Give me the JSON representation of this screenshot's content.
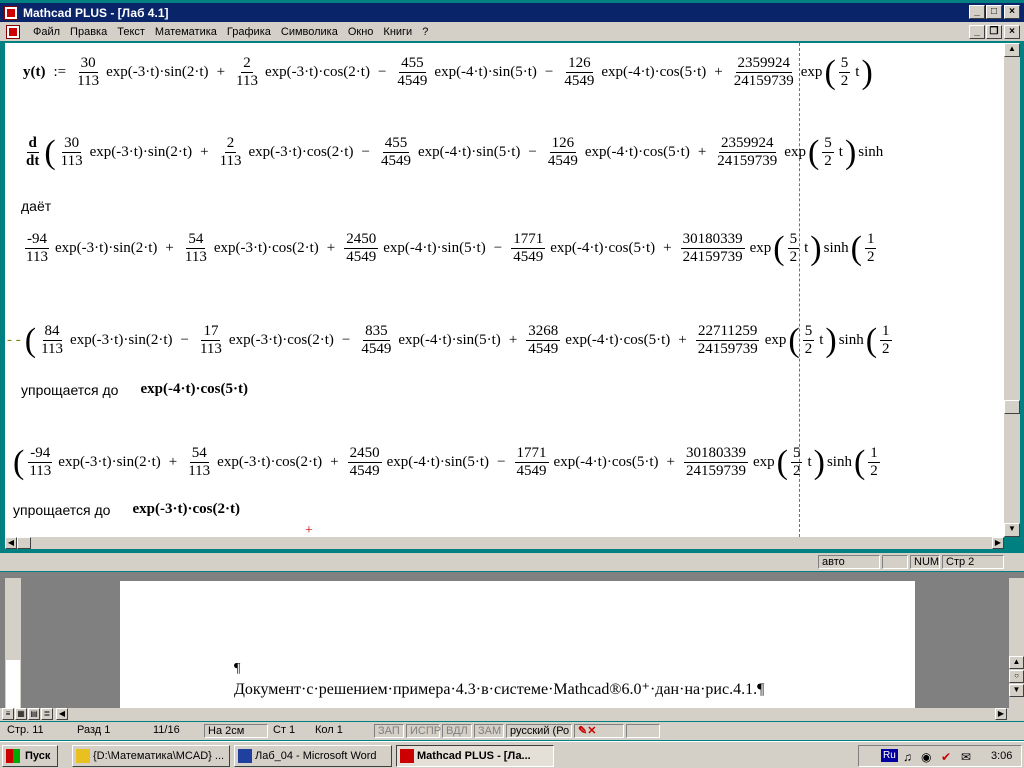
{
  "window": {
    "title": "Mathcad PLUS - [Лаб 4.1]"
  },
  "menu": [
    "Файл",
    "Правка",
    "Текст",
    "Математика",
    "Графика",
    "Символика",
    "Окно",
    "Книги",
    "?"
  ],
  "math": {
    "y_label": "y(t)",
    "assign": ":=",
    "deriv_d": "d",
    "deriv_dt": "dt",
    "gives": "даёт",
    "simplifies1": "упрощается до",
    "result1": "exp(-4·t)·cos(5·t)",
    "simplifies2": "упрощается до",
    "result2": "exp(-3·t)·cos(2·t)",
    "row1": {
      "n1": "30",
      "d1": "113",
      "t1": "exp(-3·t)·sin(2·t)",
      "o1": "+",
      "n2": "2",
      "d2": "113",
      "t2": "exp(-3·t)·cos(2·t)",
      "o2": "−",
      "n3": "455",
      "d3": "4549",
      "t3": "exp(-4·t)·sin(5·t)",
      "o3": "−",
      "n4": "126",
      "d4": "4549",
      "t4": "exp(-4·t)·cos(5·t)",
      "o4": "+",
      "n5": "2359924",
      "d5": "24159739",
      "t5": "exp",
      "n6": "5",
      "d6": "2",
      "t6": "t"
    },
    "row3": {
      "n1": "-94",
      "d1": "113",
      "t1": "exp(-3·t)·sin(2·t)",
      "o1": "+",
      "n2": "54",
      "d2": "113",
      "t2": "exp(-3·t)·cos(2·t)",
      "o2": "+",
      "n3": "2450",
      "d3": "4549",
      "t3": "exp(-4·t)·sin(5·t)",
      "o3": "−",
      "n4": "1771",
      "d4": "4549",
      "t4": "exp(-4·t)·cos(5·t)",
      "o4": "+",
      "n5": "30180339",
      "d5": "24159739",
      "t5": "exp",
      "n6": "5",
      "d6": "2",
      "t6": "t",
      "t7": "sinh",
      "n7": "1",
      "d7": "2"
    },
    "row4": {
      "n1": "84",
      "d1": "113",
      "t1": "exp(-3·t)·sin(2·t)",
      "o1": "−",
      "n2": "17",
      "d2": "113",
      "t2": "exp(-3·t)·cos(2·t)",
      "o2": "−",
      "n3": "835",
      "d3": "4549",
      "t3": "exp(-4·t)·sin(5·t)",
      "o3": "+",
      "n4": "3268",
      "d4": "4549",
      "t4": "exp(-4·t)·cos(5·t)",
      "o4": "+",
      "n5": "22711259",
      "d5": "24159739",
      "t5": "exp",
      "n6": "5",
      "d6": "2",
      "t6": "t",
      "t7": "sinh",
      "n7": "1",
      "d7": "2"
    }
  },
  "mathcad_status": {
    "mode": "авто",
    "num": "NUM",
    "page": "Стр 2"
  },
  "word": {
    "pilcrow": "¶",
    "line": "Документ·с·решением·примера·4.3·в·системе·Mathcad®6.0⁺·дан·на·рис.4.1.¶"
  },
  "word_status": {
    "page": "Стр.  11",
    "section": "Разд  1",
    "pages": "11/16",
    "pos": "На  2см",
    "line": "Ст  1",
    "col": "Кол  1",
    "rec": "ЗАП",
    "trk": "ИСПР",
    "ext": "ВДЛ",
    "ovr": "ЗАМ",
    "lang": "русский (Ро"
  },
  "taskbar": {
    "start": "Пуск",
    "task1": "{D:\\Математика\\MCAD} ...",
    "task2": "Лаб_04 - Microsoft Word",
    "task3": "Mathcad PLUS - [Ла...",
    "lang": "Ru",
    "clock": "3:06"
  }
}
